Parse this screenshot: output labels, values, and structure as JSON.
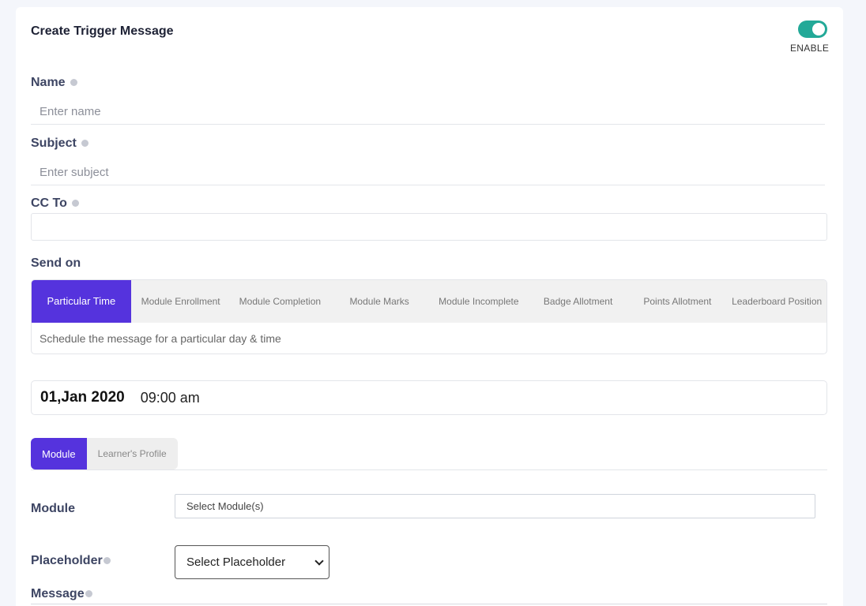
{
  "form": {
    "title": "Create Trigger Message",
    "enable_label": "ENABLE",
    "enabled": true,
    "accent_color": "#23a998",
    "primary_color": "#5533dd"
  },
  "fields": {
    "name": {
      "label": "Name",
      "placeholder": "Enter name",
      "value": ""
    },
    "subject": {
      "label": "Subject",
      "placeholder": "Enter subject",
      "value": ""
    },
    "cc": {
      "label": "CC To",
      "value": ""
    }
  },
  "send_on": {
    "label": "Send on",
    "tabs": [
      {
        "label": "Particular Time",
        "active": true
      },
      {
        "label": "Module Enrollment",
        "active": false
      },
      {
        "label": "Module Completion",
        "active": false
      },
      {
        "label": "Module Marks",
        "active": false
      },
      {
        "label": "Module Incomplete",
        "active": false
      },
      {
        "label": "Badge Allotment",
        "active": false
      },
      {
        "label": "Points Allotment",
        "active": false
      },
      {
        "label": "Leaderboard Position",
        "active": false
      }
    ],
    "description": "Schedule the message for a particular day & time"
  },
  "schedule": {
    "date": "01,Jan 2020",
    "time": "09:00 am"
  },
  "audience": {
    "tabs": [
      {
        "label": "Module",
        "active": true
      },
      {
        "label": "Learner's Profile",
        "active": false
      }
    ]
  },
  "module": {
    "label": "Module",
    "placeholder": "Select Module(s)"
  },
  "placeholder": {
    "label": "Placeholder",
    "selected": "Select Placeholder"
  },
  "message": {
    "label": "Message"
  },
  "icons": {
    "info": "info-icon",
    "dropdown": "chevron-down-icon"
  }
}
